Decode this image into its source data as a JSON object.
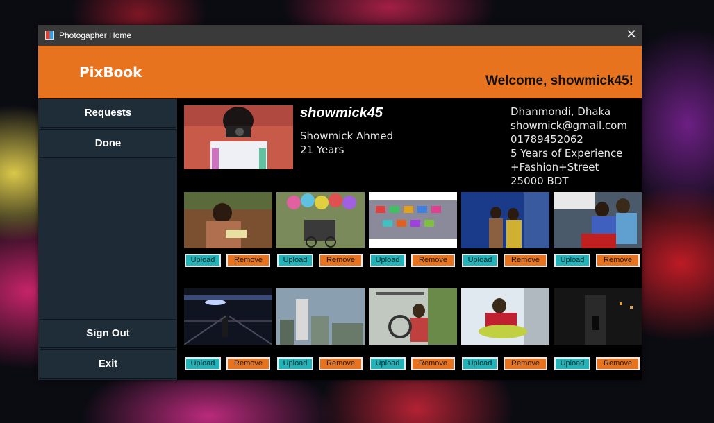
{
  "window": {
    "title": "Photogapher Home"
  },
  "header": {
    "brand": "PixBook",
    "welcome": "Welcome, showmick45!"
  },
  "sidebar": {
    "items": [
      {
        "label": "Requests"
      },
      {
        "label": "Done"
      }
    ],
    "bottom_items": [
      {
        "label": "Sign Out"
      },
      {
        "label": "Exit"
      }
    ]
  },
  "profile": {
    "username": "showmick45",
    "full_name": "Showmick Ahmed",
    "age": "21 Years",
    "location": "Dhanmondi, Dhaka",
    "email": "showmick@gmail.com",
    "phone": "01789452062",
    "experience": "5 Years of Experience",
    "specialty": "+Fashion+Street",
    "rate": "25000 BDT"
  },
  "gallery": {
    "upload_label": "Upload",
    "remove_label": "Remove"
  },
  "colors": {
    "accent": "#e8731f",
    "upload": "#22b2b8",
    "sidebar": "#1f2d39"
  }
}
